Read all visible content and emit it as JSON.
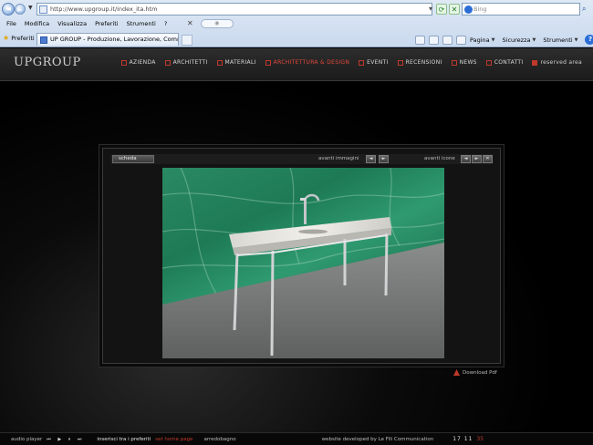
{
  "browser": {
    "url": "http://www.upgroup.it/index_ita.htm",
    "search_placeholder": "Bing",
    "menu": [
      "File",
      "Modifica",
      "Visualizza",
      "Preferiti",
      "Strumenti",
      "?"
    ],
    "favorites_label": "Preferiti",
    "tab_title": "UP GROUP - Produzione, Lavorazione, Commercio Mar...",
    "commands": {
      "page": "Pagina",
      "security": "Sicurezza",
      "tools": "Strumenti"
    }
  },
  "site": {
    "logo": "UPGROUP",
    "nav": [
      {
        "label": "azienda",
        "active": false
      },
      {
        "label": "architetti",
        "active": false
      },
      {
        "label": "materiali",
        "active": false
      },
      {
        "label": "architettura & design",
        "active": true
      },
      {
        "label": "eventi",
        "active": false
      },
      {
        "label": "recensioni",
        "active": false
      },
      {
        "label": "news",
        "active": false
      },
      {
        "label": "contatti",
        "active": false
      },
      {
        "label": "reserved area",
        "active": false
      }
    ],
    "gallery": {
      "scheda": "scheda",
      "images_label": "avanti immagini",
      "icons_label": "avanti icone",
      "prev": "◄",
      "next": "►"
    },
    "download": "Download Pdf",
    "footer": {
      "audio": "audio player",
      "controls": "⏮ ▶ ⏸ ⏭",
      "favorites": "inserisci tra i preferiti",
      "homepage": "set home page",
      "arredo": "arredobagno",
      "developer": "website developed by Le Fili Communication",
      "time": "17  11",
      "seconds": "35"
    }
  },
  "colors": {
    "accent": "#c0392b",
    "marble": "#1f8a5c"
  }
}
